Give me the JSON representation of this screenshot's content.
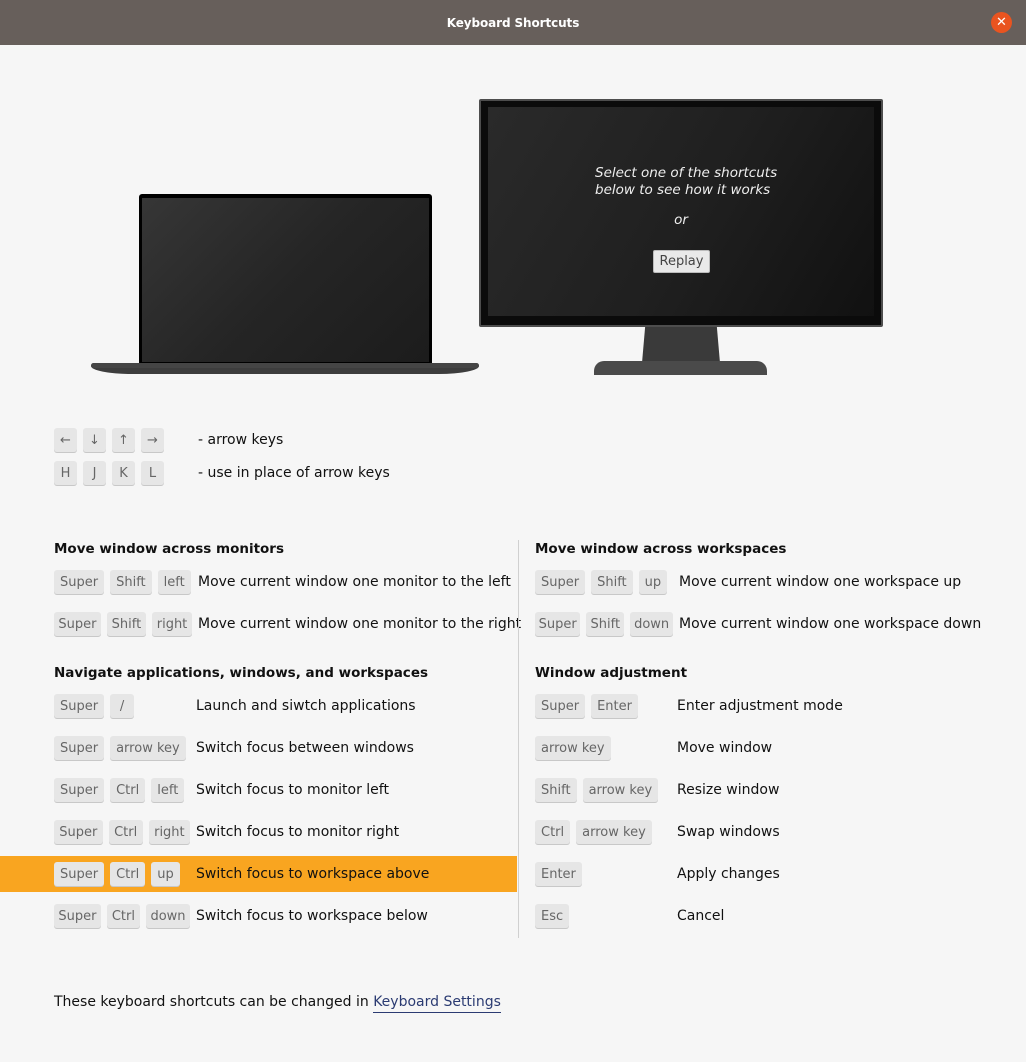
{
  "window": {
    "title": "Keyboard Shortcuts",
    "close_icon": "close-icon"
  },
  "preview": {
    "message_line1": "Select one of the shortcuts",
    "message_line2": "below to see how it works",
    "or": "or",
    "replay_label": "Replay"
  },
  "legend": [
    {
      "keys": [
        "←",
        "↓",
        "↑",
        "→"
      ],
      "text": "- arrow keys"
    },
    {
      "keys": [
        "H",
        "J",
        "K",
        "L"
      ],
      "text": "- use in place of arrow keys"
    }
  ],
  "sections": {
    "monitors": {
      "title": "Move window across monitors",
      "rows": [
        {
          "keys": [
            "Super",
            "Shift",
            "left"
          ],
          "desc": "Move current window one monitor to the left"
        },
        {
          "keys": [
            "Super",
            "Shift",
            "right"
          ],
          "desc": "Move current window one monitor to the right"
        }
      ]
    },
    "workspaces": {
      "title": "Move window across workspaces",
      "rows": [
        {
          "keys": [
            "Super",
            "Shift",
            "up"
          ],
          "desc": "Move current window one workspace up"
        },
        {
          "keys": [
            "Super",
            "Shift",
            "down"
          ],
          "desc": "Move current window one workspace down"
        }
      ]
    },
    "navigate": {
      "title": "Navigate applications, windows, and workspaces",
      "rows": [
        {
          "keys": [
            "Super",
            "/"
          ],
          "desc": "Launch and siwtch applications"
        },
        {
          "keys": [
            "Super",
            "arrow key"
          ],
          "desc": "Switch focus between windows"
        },
        {
          "keys": [
            "Super",
            "Ctrl",
            "left"
          ],
          "desc": "Switch focus to monitor left"
        },
        {
          "keys": [
            "Super",
            "Ctrl",
            "right"
          ],
          "desc": "Switch focus to monitor right"
        },
        {
          "keys": [
            "Super",
            "Ctrl",
            "up"
          ],
          "desc": "Switch focus to workspace above",
          "selected": true
        },
        {
          "keys": [
            "Super",
            "Ctrl",
            "down"
          ],
          "desc": "Switch focus to workspace below"
        }
      ]
    },
    "adjust": {
      "title": "Window adjustment",
      "rows": [
        {
          "keys": [
            "Super",
            "Enter"
          ],
          "desc": "Enter adjustment mode"
        },
        {
          "keys": [
            "arrow key"
          ],
          "desc": "Move window"
        },
        {
          "keys": [
            "Shift",
            "arrow key"
          ],
          "desc": "Resize window"
        },
        {
          "keys": [
            "Ctrl",
            "arrow key"
          ],
          "desc": "Swap windows"
        },
        {
          "keys": [
            "Enter"
          ],
          "desc": "Apply changes"
        },
        {
          "keys": [
            "Esc"
          ],
          "desc": "Cancel"
        }
      ]
    }
  },
  "footer": {
    "text": "These keyboard shortcuts can be changed in ",
    "link": "Keyboard Settings"
  },
  "colors": {
    "titlebar": "#675f5b",
    "close": "#e95420",
    "highlight": "#f9a520",
    "link": "#2b3b72"
  }
}
